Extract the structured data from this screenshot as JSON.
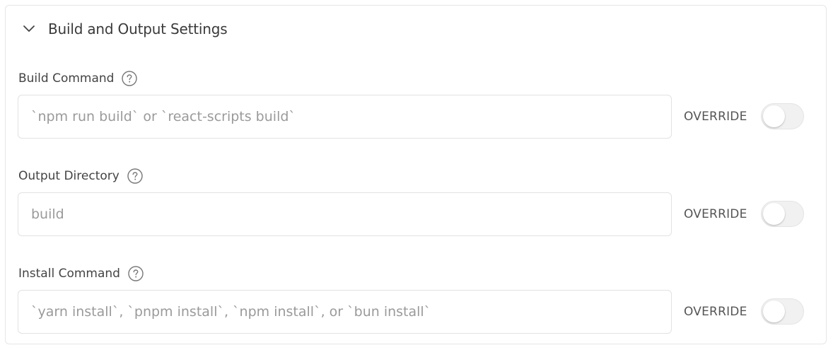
{
  "section": {
    "title": "Build and Output Settings",
    "icon": "chevron-down-icon",
    "expanded": true
  },
  "fields": [
    {
      "label": "Build Command",
      "placeholder": "`npm run build` or `react-scripts build`",
      "value": "",
      "override_label": "OVERRIDE",
      "override_on": false
    },
    {
      "label": "Output Directory",
      "placeholder": "build",
      "value": "",
      "override_label": "OVERRIDE",
      "override_on": false
    },
    {
      "label": "Install Command",
      "placeholder": "`yarn install`, `pnpm install`, `npm install`, or `bun install`",
      "value": "",
      "override_label": "OVERRIDE",
      "override_on": false
    }
  ],
  "colors": {
    "border": "#e2e2e2",
    "text": "#3a3a3a",
    "placeholder": "#9a9a9a",
    "toggle_off": "#f1f1f1"
  }
}
